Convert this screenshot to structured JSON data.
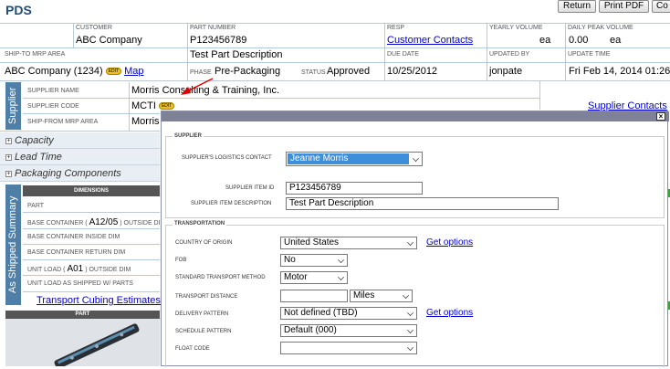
{
  "header": {
    "title": "PDS",
    "buttons": [
      "Return",
      "Print PDF",
      "Co"
    ]
  },
  "info": {
    "customer_label": "CUSTOMER",
    "customer": "ABC Company",
    "part_number_label": "PART NUMBER",
    "part_number": "P123456789",
    "resp_label": "RESP",
    "resp_link": "Customer Contacts",
    "yearly_volume_label": "YEARLY VOLUME",
    "yearly_volume_unit": "ea",
    "daily_peak_label": "DAILY PEAK VOLUME",
    "daily_peak_value": "0.00",
    "daily_peak_unit": "ea",
    "ship_to_label": "SHIP-TO MRP AREA",
    "description": "Test Part Description",
    "due_date_label": "DUE DATE",
    "updated_by_label": "UPDATED BY",
    "update_time_label": "UPDATE TIME",
    "ship_to": "ABC Company (1234)",
    "edit_label": "EDIT",
    "map_link": "Map",
    "phase_label": "PHASE",
    "phase": "Pre-Packaging",
    "status_label": "STATUS",
    "status": "Approved",
    "due_date": "10/25/2012",
    "updated_by": "jonpate",
    "update_time": "Fri Feb 14, 2014 01:26 F"
  },
  "supplier": {
    "tab": "Supplier",
    "name_label": "SUPPLIER NAME",
    "name": "Morris Consulting & Training, Inc.",
    "code_label": "SUPPLIER CODE",
    "code": "MCTI",
    "ship_from_label": "SHIP-FROM MRP AREA",
    "ship_from": "Morris",
    "contacts_link": "Supplier Contacts"
  },
  "sections": [
    "Capacity",
    "Lead Time",
    "Packaging Components"
  ],
  "summary": {
    "tab": "As Shipped Summary",
    "dimensions_header": "DIMENSIONS",
    "part_label": "PART",
    "base_container_label_pre": "BASE CONTAINER (",
    "base_container_code": "A12/05",
    "base_container_label_post": ") OUTSIDE DI",
    "inside_dim": "BASE CONTAINER INSIDE DIM",
    "return_dim": "BASE CONTAINER RETURN DIM",
    "unit_load_pre": "UNIT LOAD (",
    "unit_load_code": "A01",
    "unit_load_post": ") OUTSIDE DIM",
    "unit_load_parts": "UNIT LOAD AS SHIPPED W/ PARTS",
    "cubing_link": "Transport Cubing Estimates",
    "part_header": "PART"
  },
  "modal": {
    "supplier_legend": "SUPPLIER",
    "logistics_contact_label": "SUPPLIER'S LOGISTICS CONTACT",
    "logistics_contact": "Jeanne Morris",
    "item_id_label": "SUPPLIER ITEM ID",
    "item_id": "P123456789",
    "item_desc_label": "SUPPLIER ITEM DESCRIPTION",
    "item_desc": "Test Part Description",
    "transport_legend": "TRANSPORTATION",
    "country_label": "COUNTRY OF ORIGIN",
    "country": "United States",
    "get_options": "Get options",
    "fob_label": "FOB",
    "fob": "No",
    "method_label": "STANDARD TRANSPORT METHOD",
    "method": "Motor",
    "distance_label": "TRANSPORT DISTANCE",
    "distance": "",
    "distance_unit": "Miles",
    "delivery_label": "DELIVERY PATTERN",
    "delivery": "Not defined (TBD)",
    "get_options2": "Get options",
    "schedule_label": "SCHEDULE PATTERN",
    "schedule": "Default (000)",
    "float_label": "FLOAT CODE",
    "float_code": ""
  },
  "colors": {
    "accent": "#4f7fa6",
    "selected": "#3d8fdc",
    "modal_header": "#7f8196",
    "link": "#0000cc"
  }
}
